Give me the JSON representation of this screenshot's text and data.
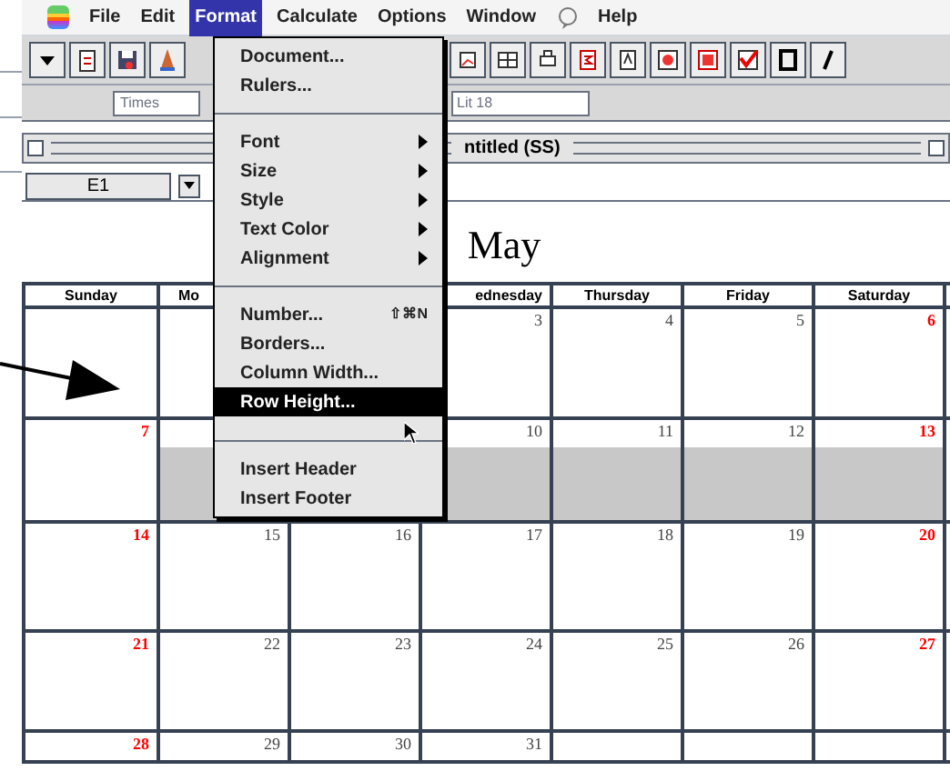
{
  "menu_bar": [
    {
      "label": "File",
      "selected": false
    },
    {
      "label": "Edit",
      "selected": false
    },
    {
      "label": "Format",
      "selected": true
    },
    {
      "label": "Calculate",
      "selected": false
    },
    {
      "label": "Options",
      "selected": false
    },
    {
      "label": "Window",
      "selected": false
    },
    {
      "label": "Help",
      "selected": false
    }
  ],
  "toolbar": {
    "font_field": "Times",
    "size_field": "Lit 18"
  },
  "window": {
    "title": "ntitled (SS)"
  },
  "entry_bar": {
    "cell_reference": "E1"
  },
  "format_menu": [
    {
      "kind": "item",
      "label": "Document...",
      "selected": false
    },
    {
      "kind": "item",
      "label": "Rulers...",
      "selected": false
    },
    {
      "kind": "separator"
    },
    {
      "kind": "submenu",
      "label": "Font",
      "selected": false
    },
    {
      "kind": "submenu",
      "label": "Size",
      "selected": false
    },
    {
      "kind": "submenu",
      "label": "Style",
      "selected": false
    },
    {
      "kind": "submenu",
      "label": "Text Color",
      "selected": false
    },
    {
      "kind": "submenu",
      "label": "Alignment",
      "selected": false
    },
    {
      "kind": "separator"
    },
    {
      "kind": "item",
      "label": "Number...",
      "shortcut": "⇧⌘N",
      "selected": false
    },
    {
      "kind": "item",
      "label": "Borders...",
      "selected": false
    },
    {
      "kind": "item",
      "label": "Column Width...",
      "selected": false
    },
    {
      "kind": "item",
      "label": "Row Height...",
      "selected": true
    },
    {
      "kind": "separator"
    },
    {
      "kind": "item",
      "label": "Insert Header",
      "selected": false
    },
    {
      "kind": "item",
      "label": "Insert Footer",
      "selected": false
    }
  ],
  "calendar": {
    "month": "May",
    "columns": [
      "Sunday",
      "Mo",
      null,
      "ednesday",
      "Thursday",
      "Friday",
      "Saturday"
    ],
    "weeks": [
      {
        "selected": false,
        "days": [
          {
            "kind": "blank"
          },
          {
            "kind": "blank"
          },
          {
            "kind": "blank"
          },
          {
            "label": "3",
            "weekend": false
          },
          {
            "label": "4",
            "weekend": false
          },
          {
            "label": "5",
            "weekend": false
          },
          {
            "label": "6",
            "weekend": true
          }
        ]
      },
      {
        "selected": true,
        "days": [
          {
            "label": "7",
            "weekend": true
          },
          {
            "kind": "blank"
          },
          {
            "kind": "blank"
          },
          {
            "label": "10",
            "weekend": false
          },
          {
            "label": "11",
            "weekend": false
          },
          {
            "label": "12",
            "weekend": false
          },
          {
            "label": "13",
            "weekend": true
          }
        ]
      },
      {
        "selected": false,
        "days": [
          {
            "label": "14",
            "weekend": true
          },
          {
            "label": "15",
            "weekend": false
          },
          {
            "label": "16",
            "weekend": false
          },
          {
            "label": "17",
            "weekend": false
          },
          {
            "label": "18",
            "weekend": false
          },
          {
            "label": "19",
            "weekend": false
          },
          {
            "label": "20",
            "weekend": true
          }
        ]
      },
      {
        "selected": false,
        "days": [
          {
            "label": "21",
            "weekend": true
          },
          {
            "label": "22",
            "weekend": false
          },
          {
            "label": "23",
            "weekend": false
          },
          {
            "label": "24",
            "weekend": false
          },
          {
            "label": "25",
            "weekend": false
          },
          {
            "label": "26",
            "weekend": false
          },
          {
            "label": "27",
            "weekend": true
          }
        ]
      },
      {
        "selected": false,
        "days": [
          {
            "label": "28",
            "weekend": true
          },
          {
            "label": "29",
            "weekend": false
          },
          {
            "label": "30",
            "weekend": false
          },
          {
            "label": "31",
            "weekend": false
          },
          {
            "kind": "blank"
          },
          {
            "kind": "blank"
          },
          {
            "kind": "blank"
          }
        ]
      }
    ]
  }
}
